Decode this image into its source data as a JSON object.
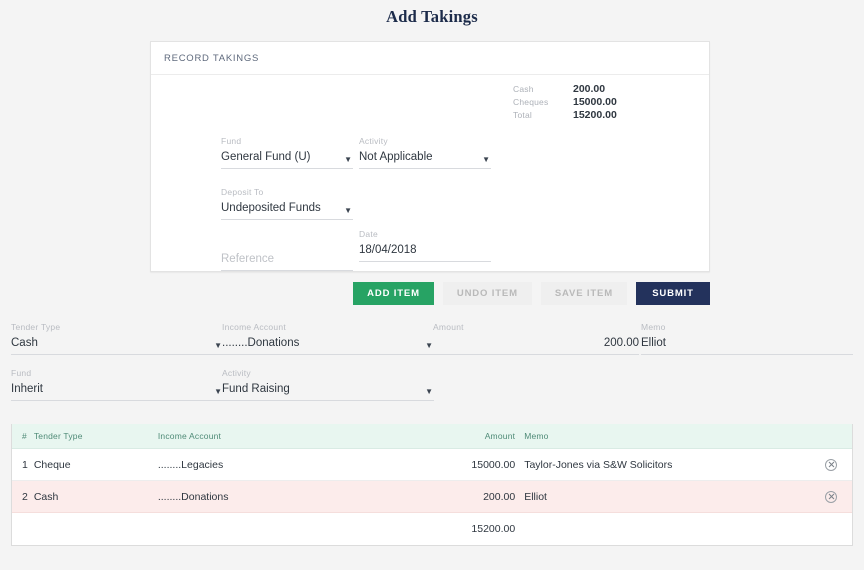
{
  "page": {
    "title": "Add Takings"
  },
  "record_card": {
    "header": "RECORD TAKINGS",
    "fields": {
      "fund": {
        "label": "Fund",
        "value": "General Fund (U)",
        "caret": "chevron-down-icon"
      },
      "activity": {
        "label": "Activity",
        "value": "Not Applicable",
        "caret": "chevron-down-icon"
      },
      "deposit_to": {
        "label": "Deposit To",
        "value": "Undeposited Funds",
        "caret": "chevron-down-icon"
      },
      "reference": {
        "label": "",
        "value": "",
        "placeholder": "Reference"
      },
      "date": {
        "label": "Date",
        "value": "18/04/2018"
      }
    },
    "summary": [
      {
        "label": "Cash",
        "value": "200.00"
      },
      {
        "label": "Cheques",
        "value": "15000.00"
      },
      {
        "label": "Total",
        "value": "15200.00"
      }
    ]
  },
  "buttons": {
    "add_item": "ADD ITEM",
    "undo_item": "UNDO ITEM",
    "save_item": "SAVE ITEM",
    "submit": "SUBMIT"
  },
  "detail_form": {
    "tender_type": {
      "label": "Tender Type",
      "value": "Cash",
      "caret": "chevron-down-icon"
    },
    "income_account": {
      "label": "Income Account",
      "value": "........Donations",
      "caret": "chevron-down-icon"
    },
    "amount": {
      "label": "Amount",
      "value": "200.00"
    },
    "memo": {
      "label": "Memo",
      "value": "Elliot"
    },
    "fund": {
      "label": "Fund",
      "value": "Inherit",
      "caret": "chevron-down-icon"
    },
    "activity": {
      "label": "Activity",
      "value": "Fund Raising",
      "caret": "chevron-down-icon"
    }
  },
  "items_table": {
    "columns": [
      "#",
      "Tender Type",
      "Income Account",
      "Amount",
      "Memo",
      ""
    ],
    "rows": [
      {
        "num": "1",
        "tender_type": "Cheque",
        "income_account": "........Legacies",
        "amount": "15000.00",
        "memo": "Taylor-Jones via S&W Solicitors",
        "delete": "delete-icon"
      },
      {
        "num": "2",
        "tender_type": "Cash",
        "income_account": "........Donations",
        "amount": "200.00",
        "memo": "Elliot",
        "delete": "delete-icon"
      }
    ],
    "footer_total": "15200.00"
  },
  "colors": {
    "background": "#f4f4f4",
    "title": "#1c2b4a",
    "primary_green": "#27a364",
    "submit_navy": "#23325c",
    "table_header_bg": "#e8f6f0",
    "alt_row_bg": "#fceceb"
  }
}
